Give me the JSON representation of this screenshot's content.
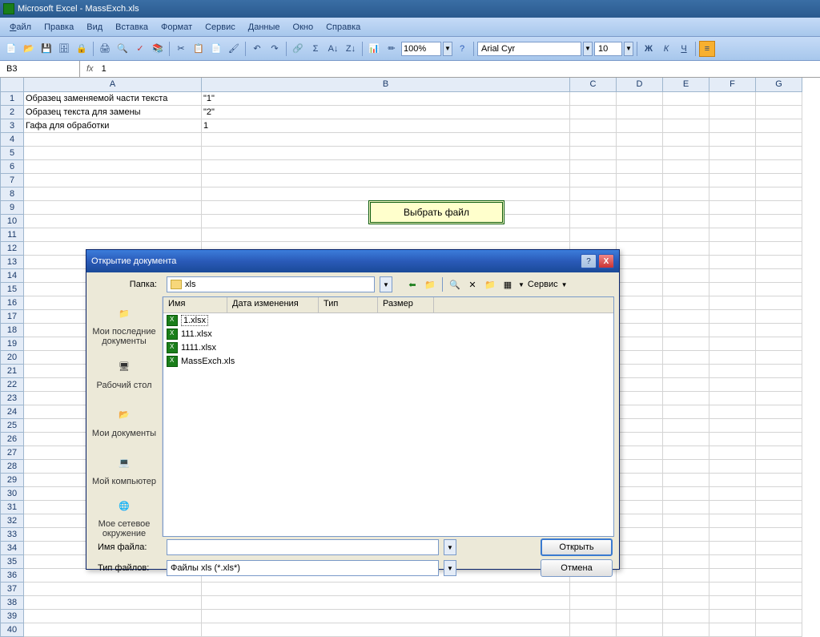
{
  "title": "Microsoft Excel - MassExch.xls",
  "menubar": [
    "Файл",
    "Правка",
    "Вид",
    "Вставка",
    "Формат",
    "Сервис",
    "Данные",
    "Окно",
    "Справка"
  ],
  "toolbar": {
    "zoom": "100%",
    "font": "Arial Cyr",
    "size": "10",
    "bold": "Ж",
    "italic": "К",
    "under": "Ч"
  },
  "formula": {
    "cellref": "B3",
    "fx": "fx",
    "value": "1"
  },
  "cols": [
    "A",
    "B",
    "C",
    "D",
    "E",
    "F",
    "G"
  ],
  "cells": {
    "A1": "Образец заменяемой части текста",
    "B1": "\"1\"",
    "A2": "Образец текста для замены",
    "B2": "\"2\"",
    "A3": "Гафа для обработки",
    "B3": "1"
  },
  "choose_btn": "Выбрать файл",
  "dlg": {
    "title": "Открытие документа",
    "folder_lbl": "Папка:",
    "folder": "xls",
    "tools": "Сервис",
    "cols": {
      "c1": "Имя",
      "c2": "Дата изменения",
      "c3": "Тип",
      "c4": "Размер"
    },
    "files": [
      "1.xlsx",
      "111.xlsx",
      "1111.xlsx",
      "MassExch.xls"
    ],
    "places": [
      "Мои последние документы",
      "Рабочий стол",
      "Мои документы",
      "Мой компьютер",
      "Мое сетевое окружение"
    ],
    "fname_lbl": "Имя файла:",
    "ftype_lbl": "Тип файлов:",
    "ftype_val": "Файлы xls (*.xls*)",
    "open": "Открыть",
    "cancel": "Отмена"
  }
}
